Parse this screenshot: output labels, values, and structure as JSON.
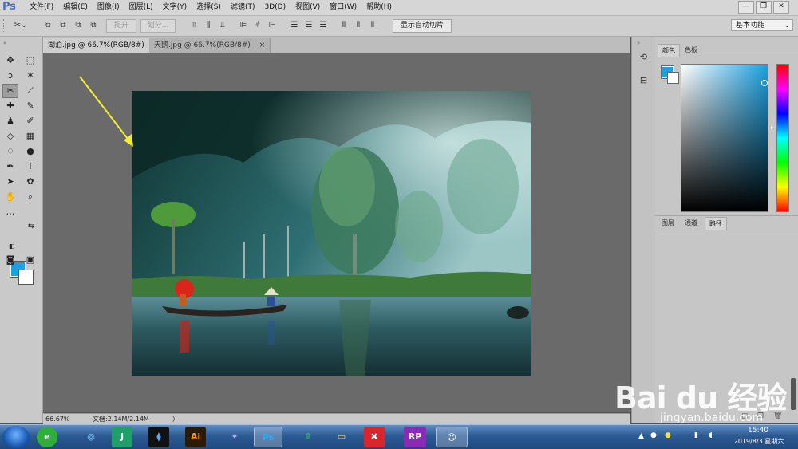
{
  "app": {
    "logo": "Ps"
  },
  "menubar": {
    "items": [
      "文件(F)",
      "编辑(E)",
      "图像(I)",
      "图层(L)",
      "文字(Y)",
      "选择(S)",
      "滤镜(T)",
      "3D(D)",
      "视图(V)",
      "窗口(W)",
      "帮助(H)"
    ],
    "minimize": "—",
    "restore": "❐",
    "close": "✕"
  },
  "options": {
    "raise_label": "提升",
    "split_label": "划分...",
    "auto_slice_label": "显示自动切片",
    "workspace": "基本功能"
  },
  "tabs": [
    {
      "label": "湖泊.jpg @ 66.7%(RGB/8#)",
      "active": true
    },
    {
      "label": "天鹅.jpg @ 66.7%(RGB/8#)",
      "active": false
    }
  ],
  "tab_close": "×",
  "status": {
    "zoom": "66.67%",
    "doc": "文档:2.14M/2.14M",
    "arrow": "〉"
  },
  "panels": {
    "color_tabs": [
      "颜色",
      "色板"
    ],
    "layer_tabs": [
      "图层",
      "通道",
      "路径"
    ]
  },
  "taskbar": {
    "apps": [
      "e",
      "◎",
      "J",
      "⧫",
      "Ai",
      "✦",
      "Ps",
      "⇧",
      "▭",
      "✖",
      "RP",
      "☺"
    ],
    "time": "15:40",
    "date": "2019/8/3 星期六"
  },
  "watermark": {
    "brand": "Bai du 经验",
    "url": "jingyan.baidu.com"
  },
  "colors": {
    "foreground": "#1ba1e2",
    "background": "#ffffff",
    "accent": "#4b6fbf"
  }
}
